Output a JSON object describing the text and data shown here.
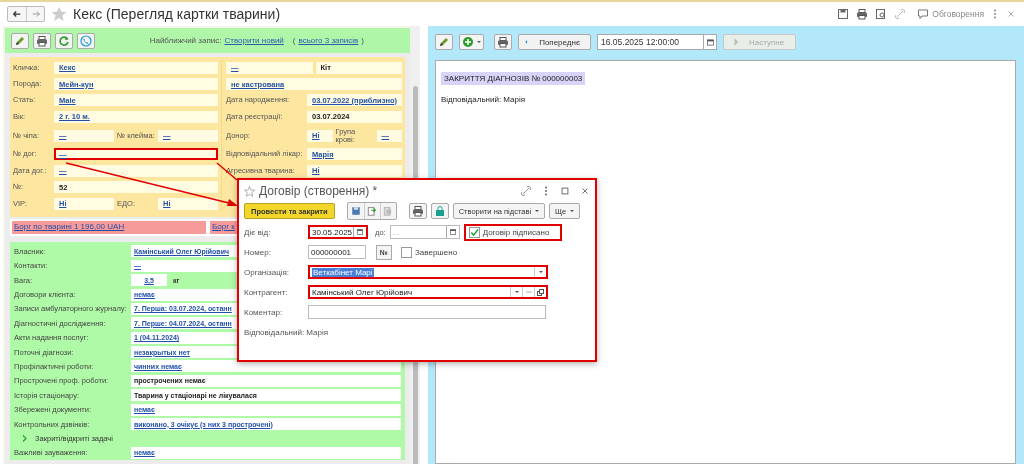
{
  "header": {
    "title": "Кекс (Перегляд картки тварини)",
    "discussion": "Обговорення"
  },
  "left": {
    "toolbar": {
      "nearest_label": "Найближчий запис:",
      "create_link": "Створити новий",
      "open_paren": "(",
      "all_link": "всього 3 записів",
      "close_paren": ")"
    },
    "card_left": [
      {
        "highlighted": false,
        "pairs": [
          {
            "label": "Кличка:",
            "value": "Кекс",
            "kind": "link"
          }
        ]
      },
      {
        "highlighted": false,
        "pairs": [
          {
            "label": "Порода:",
            "value": "Мейн-кун",
            "kind": "link"
          }
        ]
      },
      {
        "highlighted": false,
        "pairs": [
          {
            "label": "Стать:",
            "value": "Male",
            "kind": "link"
          }
        ]
      },
      {
        "highlighted": false,
        "pairs": [
          {
            "label": "Вік:",
            "value": "2 г. 10 м.",
            "kind": "link"
          }
        ]
      },
      {
        "highlighted": false,
        "pairs": [
          {
            "label": "№ чіпа:",
            "value": "—",
            "kind": "link"
          },
          {
            "label": "№ клейма:",
            "value": "—",
            "kind": "link"
          }
        ]
      },
      {
        "highlighted": true,
        "pairs": [
          {
            "label": "№ дог:",
            "value": "—",
            "kind": "link"
          }
        ]
      },
      {
        "highlighted": false,
        "pairs": [
          {
            "label": "Дата дог.:",
            "value": "—",
            "kind": "link"
          }
        ]
      },
      {
        "highlighted": false,
        "pairs": [
          {
            "label": "№:",
            "value": "52",
            "kind": "plain"
          }
        ]
      },
      {
        "highlighted": false,
        "pairs": [
          {
            "label": "VIP:",
            "value": "Ні",
            "kind": "link"
          },
          {
            "label": "ЕДО:",
            "value": "Ні",
            "kind": "link"
          }
        ]
      }
    ],
    "card_right": [
      {
        "pairs": [
          {
            "value": "—",
            "kind": "link"
          },
          {
            "value": "Кіт",
            "kind": "plain"
          }
        ]
      },
      {
        "pairs": [
          {
            "value": "не кастрована",
            "kind": "link"
          }
        ]
      },
      {
        "pairs": [
          {
            "label": "Дата народження:",
            "value": "03.07.2022 (приблизно)",
            "kind": "link"
          }
        ]
      },
      {
        "pairs": [
          {
            "label": "Дата реєстрації:",
            "value": "03.07.2024",
            "kind": "plain"
          }
        ]
      },
      {
        "pairs": [
          {
            "label": "Донор:",
            "value": "Ні",
            "kind": "link"
          },
          {
            "label": "Група крові:",
            "value": "—",
            "kind": "link"
          }
        ]
      },
      {
        "pairs": [
          {
            "label": "Відповідальний лікар:",
            "value": "Марія",
            "kind": "link"
          }
        ]
      },
      {
        "pairs": [
          {
            "label": "Агресивна тварина:",
            "value": "Ні",
            "kind": "link"
          }
        ]
      }
    ],
    "debts": [
      "Борг по тварині 1 196,00 UAH",
      "Борг к"
    ],
    "owner_rows": [
      {
        "kind": "link",
        "label": "Власник:",
        "value": "Камінський Олег Юрійович"
      },
      {
        "kind": "link",
        "label": "Контакти:",
        "value": "—"
      },
      {
        "kind": "weight",
        "label": "Вага:",
        "value": "3,5",
        "unit": "кг"
      },
      {
        "kind": "link",
        "label": "Договори клієнта:",
        "value": "немає"
      },
      {
        "kind": "link",
        "label": "Записи амбулаторного журналу:",
        "value": "7. Перша: 03.07.2024, останн"
      },
      {
        "kind": "link",
        "label": "Діагностичні дослідження:",
        "value": "7. Перше: 04.07.2024, останн"
      },
      {
        "kind": "link",
        "label": "Акти надання послуг:",
        "value": "1 (04.11.2024)"
      },
      {
        "kind": "link",
        "label": "Поточні діагнози:",
        "value": "незакрытых нет"
      },
      {
        "kind": "link",
        "label": "Профілактичні роботи:",
        "value": "чинних немає"
      },
      {
        "kind": "plain",
        "label": "Прострочені проф. роботи:",
        "value": "прострочених немає"
      },
      {
        "kind": "plain",
        "label": "Історія стаціонару:",
        "value": "Тварина у стаціонарі не лікувалася"
      },
      {
        "kind": "link",
        "label": "Збережені документи:",
        "value": "немає"
      },
      {
        "kind": "link",
        "label": "Контрольних дзвінків:",
        "value": " виконано, 3 очікує (з них 3 прострочені)"
      },
      {
        "kind": "expander",
        "label": "Закриті/відкриті задачі",
        "expanded": false
      },
      {
        "kind": "link",
        "label": "Важливі зауваження:",
        "value": "немає"
      }
    ]
  },
  "right": {
    "toolbar": {
      "prev": "Попереднє",
      "date": "16.05.2025 12:00:00",
      "next": "Наступне",
      "next_disabled": true
    },
    "document": {
      "title": "ЗАКРИТТЯ ДІАГНОЗІВ № 000000003",
      "responsible": "Відповідальний: Марія"
    }
  },
  "dialog": {
    "title": "Договір (створення) *",
    "highlighted": true,
    "post_button": "Провести та закрити",
    "create_based": "Створити на підставі",
    "more": "Ще",
    "from_label": "Діє від:",
    "from_value": "30.05.2025",
    "from_highlighted": true,
    "to_label": "до:",
    "to_placeholder": ". .",
    "signed": {
      "label": "Договір підписано",
      "checked": true,
      "highlighted": true
    },
    "number_label": "Номер:",
    "number_value": "000000001",
    "number_button": "№",
    "completed": {
      "label": "Завершено",
      "checked": false
    },
    "org_label": "Організація:",
    "org_value": "Веткабінет Марі",
    "org_text_selected": true,
    "org_highlighted": true,
    "contractor_label": "Контрагент:",
    "contractor_value": "Камінський Олег Юрійович",
    "contractor_highlighted": true,
    "comment_label": "Коментар:",
    "responsible": "Відповідальний: Марія"
  }
}
